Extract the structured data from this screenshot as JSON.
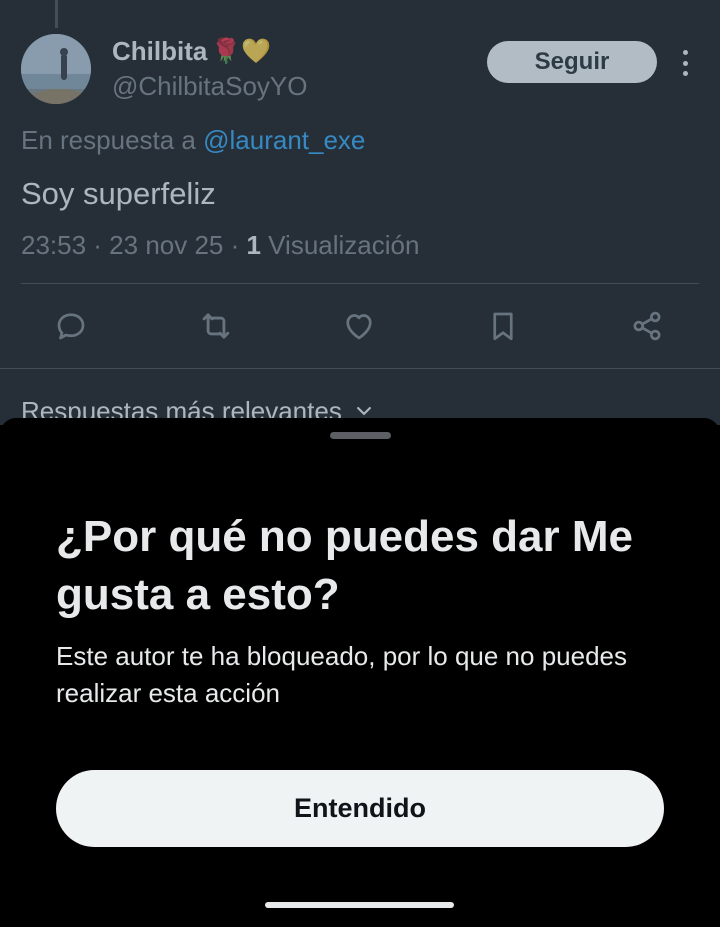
{
  "tweet": {
    "display_name": "Chilbita",
    "name_emojis": "🌹💛",
    "handle": "@ChilbitaSoyYO",
    "follow_label": "Seguir",
    "reply_prefix": "En respuesta a",
    "reply_mention": "@laurant_exe",
    "text": "Soy superfeliz",
    "timestamp": "23:53 · 23 nov 25 · ",
    "view_count": "1",
    "view_label": " Visualización",
    "actions": [
      "reply-icon",
      "retweet-icon",
      "like-icon",
      "bookmark-icon",
      "share-icon"
    ]
  },
  "replies": {
    "sort_label": "Respuestas más relevantes"
  },
  "sheet": {
    "title": "¿Por qué no puedes dar Me gusta a esto?",
    "body": "Este autor te ha bloqueado, por lo que no puedes realizar esta acción",
    "button_label": "Entendido"
  },
  "colors": {
    "background": "#000000",
    "text_primary": "#e7e9ea",
    "text_secondary": "#71767b",
    "link": "#1d9bf0",
    "button_bg": "#eff3f4"
  }
}
